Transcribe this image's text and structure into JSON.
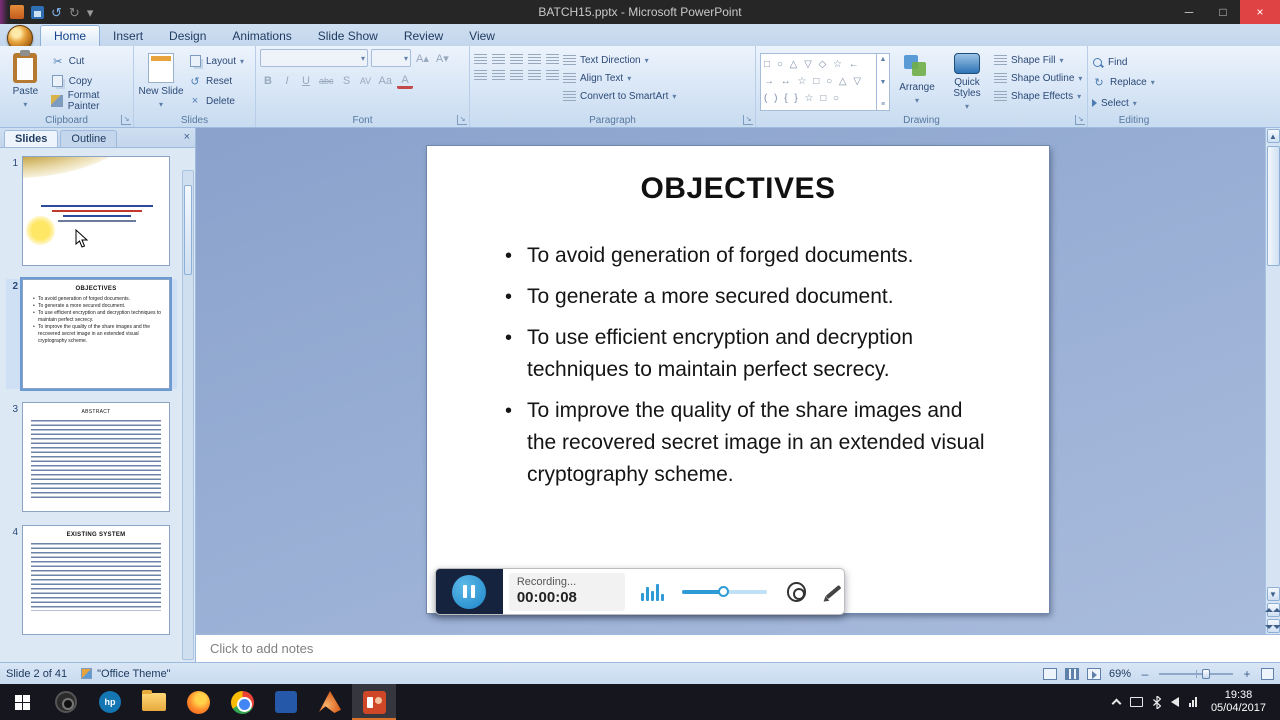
{
  "window": {
    "title": "BATCH15.pptx - Microsoft PowerPoint"
  },
  "icons": {
    "minimize": "─",
    "maximize": "□",
    "close": "×",
    "dropdown": "▾",
    "undo": "↺",
    "redo": "↻",
    "cut": "✂",
    "up_arrow": "▲",
    "down_arrow": "▼",
    "launcher": "↘",
    "pane_close": "×",
    "shape_rows": [
      "□ ○ △ ▽ ◇ ☆ ←",
      "→ ↔ ☆ □ ○ △ ▽",
      "( ) { } ☆ □ ○"
    ],
    "scroll_more": "≡"
  },
  "ribbon": {
    "tabs": [
      {
        "label": "Home"
      },
      {
        "label": "Insert"
      },
      {
        "label": "Design"
      },
      {
        "label": "Animations"
      },
      {
        "label": "Slide Show"
      },
      {
        "label": "Review"
      },
      {
        "label": "View"
      }
    ],
    "groups": {
      "clipboard": {
        "label": "Clipboard",
        "paste": "Paste",
        "cut": "Cut",
        "copy": "Copy",
        "format_painter": "Format Painter"
      },
      "slides": {
        "label": "Slides",
        "new_slide": "New Slide",
        "layout": "Layout",
        "reset": "Reset",
        "delete": "Delete"
      },
      "font": {
        "label": "Font",
        "bold": "B",
        "italic": "I",
        "underline": "U",
        "strike": "abc",
        "shadow": "S",
        "spacing": "AV",
        "case": "Aa",
        "color": "A",
        "grow": "A▴",
        "shrink": "A▾"
      },
      "paragraph": {
        "label": "Paragraph",
        "text_direction": "Text Direction",
        "align_text": "Align Text",
        "convert": "Convert to SmartArt"
      },
      "drawing": {
        "label": "Drawing",
        "arrange": "Arrange",
        "quick_styles": "Quick Styles",
        "shape_fill": "Shape Fill",
        "shape_outline": "Shape Outline",
        "shape_effects": "Shape Effects"
      },
      "editing": {
        "label": "Editing",
        "find": "Find",
        "replace": "Replace",
        "select": "Select"
      }
    }
  },
  "slides_panel": {
    "tabs": {
      "slides": "Slides",
      "outline": "Outline"
    },
    "thumbnails": [
      {
        "number": "1"
      },
      {
        "number": "2",
        "title": "OBJECTIVES"
      },
      {
        "number": "3",
        "title": "ABSTRACT"
      },
      {
        "number": "4",
        "title": "EXISTING SYSTEM"
      }
    ]
  },
  "slide": {
    "title": "OBJECTIVES",
    "bullets": [
      "To avoid generation of forged documents.",
      "To generate a more secured document.",
      "To use efficient encryption and decryption techniques to maintain perfect secrecy.",
      "To improve the quality of the share images and the recovered secret image in an extended visual cryptography scheme."
    ]
  },
  "recorder": {
    "status": "Recording...",
    "time": "00:00:08"
  },
  "notes": {
    "placeholder": "Click to add notes"
  },
  "statusbar": {
    "slide_info": "Slide 2 of 41",
    "theme": "\"Office Theme\"",
    "zoom": "69%",
    "zoom_out": "–",
    "zoom_in": "+"
  },
  "taskbar": {
    "time": "19:38",
    "date": "05/04/2017"
  }
}
